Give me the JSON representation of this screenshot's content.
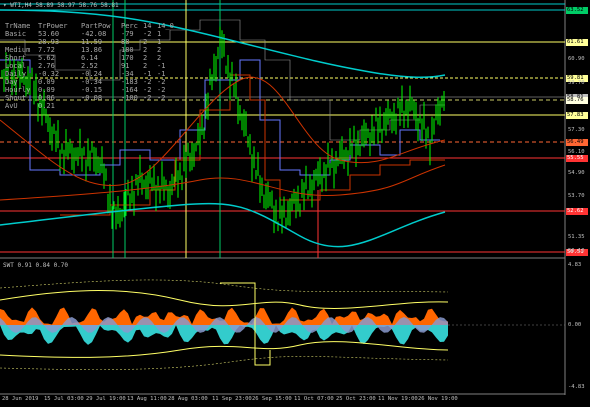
{
  "main_title": "WTI,H4  58.89 58.97 58.76 58.81",
  "stats": {
    "header": [
      "TrName",
      "TrPower",
      "PartPow",
      "Perc",
      "14",
      "14_0"
    ],
    "rows": [
      [
        "Basic",
        "53.60",
        "-42.08",
        "-79",
        "-2",
        "1"
      ],
      [
        "",
        "28.93",
        "11.59",
        "88",
        "2",
        "1"
      ],
      [
        "Medium",
        "7.72",
        "13.86",
        "180",
        "2",
        "2"
      ],
      [
        "Short",
        "5.62",
        "6.14",
        "170",
        "2",
        "2"
      ],
      [
        "Local",
        "2.76",
        "2.52",
        "91",
        "2",
        "-1"
      ],
      [
        "Daily",
        "-0.32",
        "-0.24",
        "-34",
        "-1",
        "-1"
      ],
      [
        "Day",
        "0.09",
        "-0.34",
        "-183",
        "-2",
        "-2"
      ],
      [
        "Hourly",
        "0.09",
        "-0.15",
        "-164",
        "-2",
        "-2"
      ],
      [
        "Shout",
        "0.06",
        "-0.08",
        "-100",
        "-2",
        "-2"
      ],
      [
        "AvU",
        "0.21",
        "",
        "",
        "",
        ""
      ]
    ]
  },
  "price_axis": [
    "60.90",
    "59.70",
    "57.30",
    "56.10",
    "54.90",
    "53.70",
    "51.35",
    "50.10"
  ],
  "price_tags": [
    {
      "text": "63.52",
      "bg": "#00cc66",
      "fg": "#000"
    },
    {
      "text": "61.61",
      "bg": "#ffff99",
      "fg": "#000"
    },
    {
      "text": "59.81",
      "bg": "#ffff99",
      "fg": "#000"
    },
    {
      "text": "58.81",
      "bg": "#c0c0c0",
      "fg": "#000"
    },
    {
      "text": "58.76",
      "bg": "#ffffe0",
      "fg": "#000"
    },
    {
      "text": "57.83",
      "bg": "#ffff99",
      "fg": "#000"
    },
    {
      "text": "56.49",
      "bg": "#ff6633",
      "fg": "#000"
    },
    {
      "text": "55.55",
      "bg": "#ff3333",
      "fg": "#fff"
    },
    {
      "text": "52.62",
      "bg": "#ff3333",
      "fg": "#fff"
    },
    {
      "text": "50.51",
      "bg": "#ff3333",
      "fg": "#fff"
    }
  ],
  "sub_title": "SWT 0.91 0.84 0.70",
  "sub_axis": [
    "4.83",
    "0.00",
    "-4.83"
  ],
  "time_axis": [
    "28 Jun 2019",
    "15 Jul 03:00",
    "29 Jul 19:00",
    "13 Aug 11:00",
    "28 Aug 03:00",
    "11 Sep 23:00",
    "26 Sep 15:00",
    "11 Oct 07:00",
    "25 Oct 23:00",
    "11 Nov 19:00",
    "26 Nov 19:00"
  ],
  "colors": {
    "candles": "#00ff00",
    "ma_cyan": "#00cccc",
    "ma_red": "#cc3300",
    "support": "#ff3333",
    "resistance": "#ffff66",
    "blue_line": "#6677ff"
  }
}
